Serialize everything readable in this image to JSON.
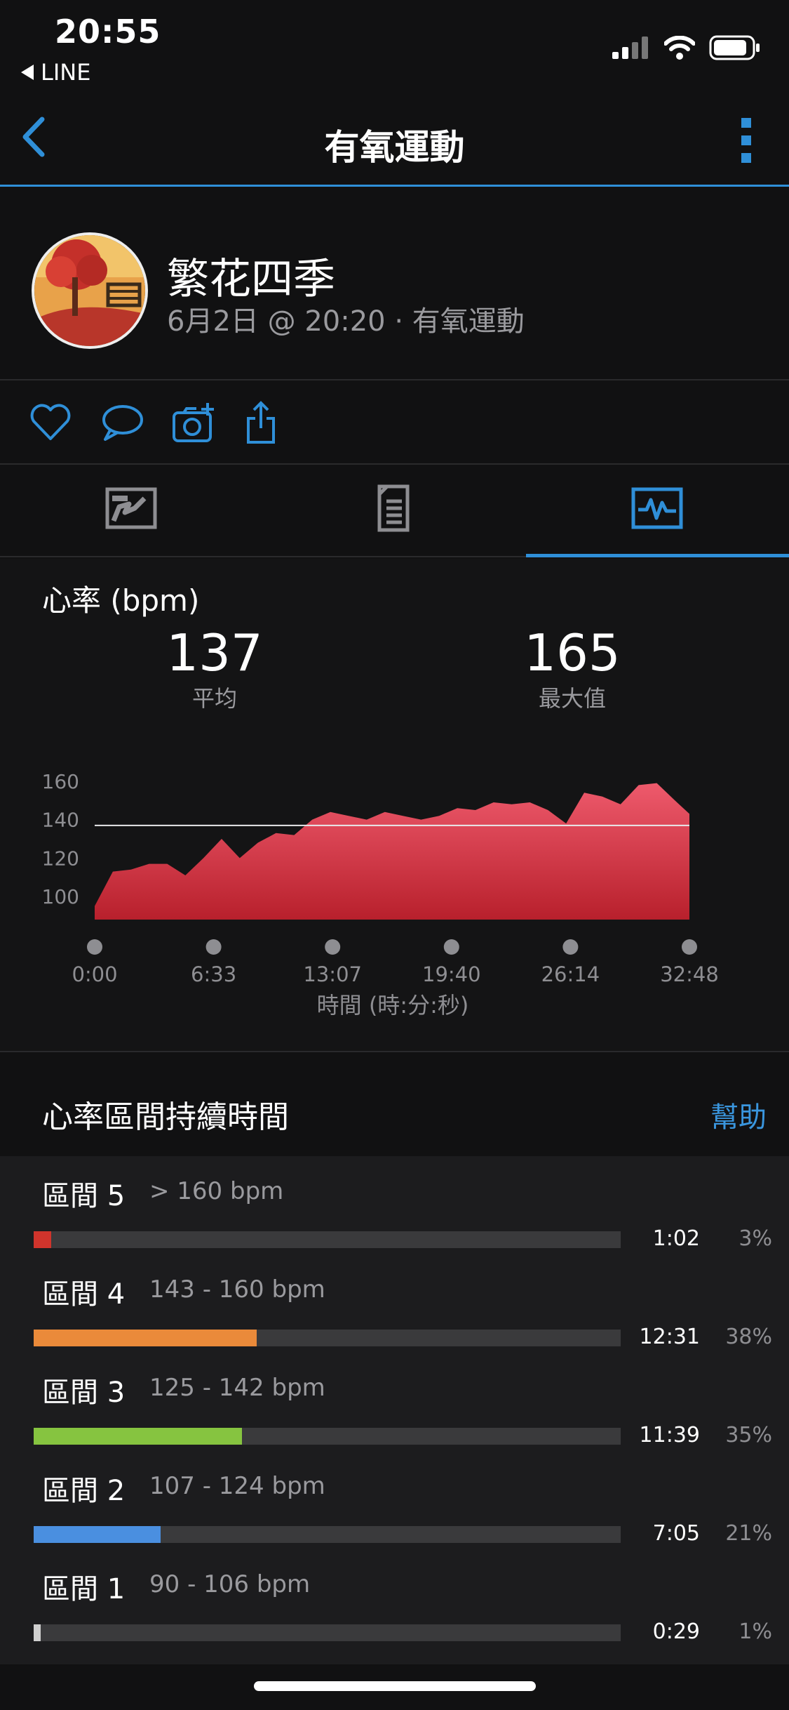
{
  "status_bar": {
    "time": "20:55",
    "back_app": "LINE",
    "icons": [
      "signal-icon",
      "wifi-icon",
      "battery-icon"
    ]
  },
  "nav": {
    "title": "有氧運動",
    "back_icon": "chevron-left-icon",
    "more_icon": "more-vertical-icon"
  },
  "profile": {
    "name": "繁花四季",
    "meta": "6月2日 @ 20:20 · 有氧運動"
  },
  "actions": [
    "heart-icon",
    "comment-icon",
    "add-photo-icon",
    "share-icon"
  ],
  "tabs": [
    {
      "icon": "map-icon",
      "active": false
    },
    {
      "icon": "details-icon",
      "active": false
    },
    {
      "icon": "chart-icon",
      "active": true
    }
  ],
  "heart_rate": {
    "title": "心率 (bpm)",
    "avg_value": "137",
    "avg_label": "平均",
    "max_value": "165",
    "max_label": "最大值"
  },
  "chart_data": {
    "type": "area",
    "ylabel": "",
    "xlabel": "時間 (時:分:秒)",
    "y_ticks": [
      100,
      140,
      120,
      160
    ],
    "x_ticks": [
      "0:00",
      "6:33",
      "13:07",
      "19:40",
      "26:14",
      "32:48"
    ],
    "x_range_seconds": [
      0,
      1968
    ],
    "ylim": [
      88,
      168
    ],
    "average_line": 137,
    "area_color": "#d93a4a",
    "x": [
      0,
      60,
      120,
      180,
      240,
      300,
      360,
      420,
      480,
      540,
      600,
      660,
      720,
      780,
      840,
      900,
      960,
      1020,
      1080,
      1140,
      1200,
      1260,
      1320,
      1380,
      1440,
      1500,
      1560,
      1620,
      1680,
      1740,
      1800,
      1860,
      1920,
      1968
    ],
    "series": [
      {
        "values": [
          95,
          113,
          114,
          117,
          117,
          111,
          120,
          130,
          120,
          128,
          133,
          132,
          140,
          144,
          142,
          140,
          144,
          142,
          140,
          142,
          146,
          145,
          149,
          148,
          149,
          145,
          138,
          154,
          152,
          148,
          158,
          159,
          150,
          143
        ]
      }
    ]
  },
  "zones_header": {
    "title": "心率區間持續時間",
    "help": "幫助"
  },
  "zones": [
    {
      "name": "區間 5",
      "range": "> 160 bpm",
      "time": "1:02",
      "pct": "3%",
      "fraction": 0.03,
      "color": "#d0342c"
    },
    {
      "name": "區間 4",
      "range": "143 - 160 bpm",
      "time": "12:31",
      "pct": "38%",
      "fraction": 0.38,
      "color": "#ea8a3a"
    },
    {
      "name": "區間 3",
      "range": "125 - 142 bpm",
      "time": "11:39",
      "pct": "35%",
      "fraction": 0.355,
      "color": "#86c440"
    },
    {
      "name": "區間 2",
      "range": "107 - 124 bpm",
      "time": "7:05",
      "pct": "21%",
      "fraction": 0.216,
      "color": "#4a8fe0"
    },
    {
      "name": "區間 1",
      "range": "90 - 106 bpm",
      "time": "0:29",
      "pct": "1%",
      "fraction": 0.012,
      "color": "#cfcfcf"
    }
  ]
}
